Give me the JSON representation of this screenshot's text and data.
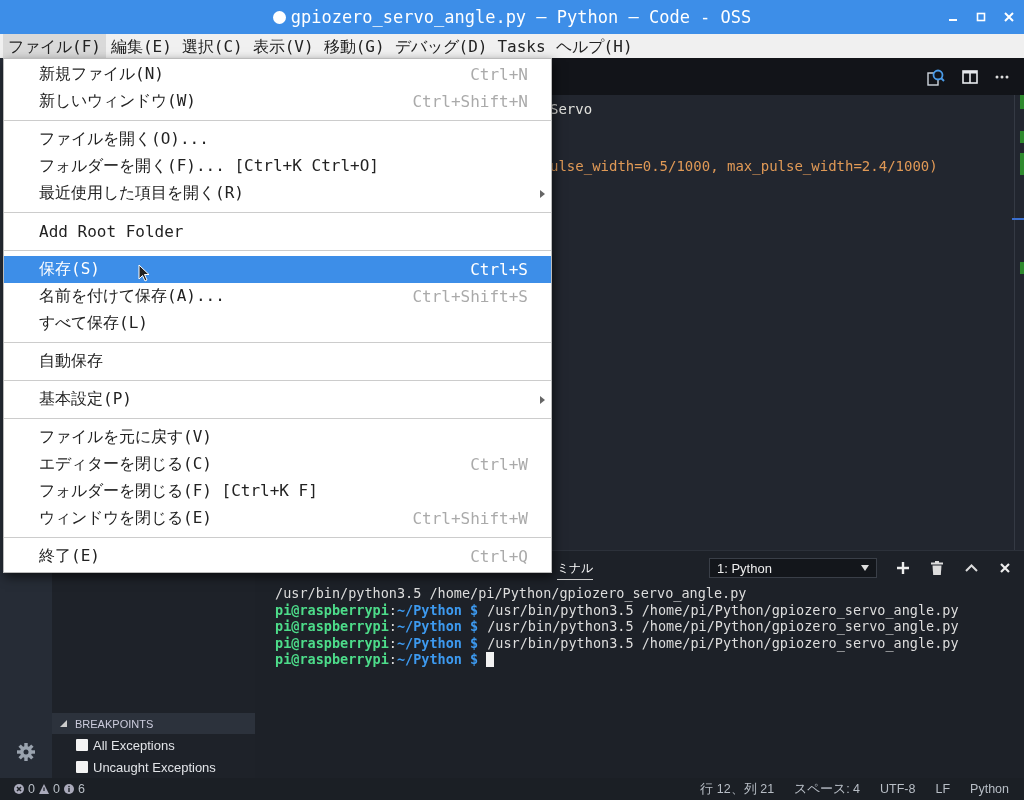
{
  "window": {
    "title": "gpiozero_servo_angle.py — Python — Code - OSS",
    "unsaved": true
  },
  "menubar": [
    {
      "label": "ファイル(F)",
      "selected": true
    },
    {
      "label": "編集(E)",
      "selected": false
    },
    {
      "label": "選択(C)",
      "selected": false
    },
    {
      "label": "表示(V)",
      "selected": false
    },
    {
      "label": "移動(G)",
      "selected": false
    },
    {
      "label": "デバッグ(D)",
      "selected": false
    },
    {
      "label": "Tasks",
      "selected": false
    },
    {
      "label": "ヘルプ(H)",
      "selected": false
    }
  ],
  "file_menu": [
    [
      {
        "label": "新規ファイル(N)",
        "shortcut": "Ctrl+N",
        "submenu": false,
        "selected": false
      },
      {
        "label": "新しいウィンドウ(W)",
        "shortcut": "Ctrl+Shift+N",
        "submenu": false,
        "selected": false
      }
    ],
    [
      {
        "label": "ファイルを開く(O)...",
        "submenu": false,
        "selected": false
      },
      {
        "label": "フォルダーを開く(F)... [Ctrl+K Ctrl+O]",
        "submenu": false,
        "selected": false
      },
      {
        "label": "最近使用した項目を開く(R)",
        "submenu": true,
        "selected": false
      }
    ],
    [
      {
        "label": "Add Root Folder",
        "submenu": false,
        "selected": false
      }
    ],
    [
      {
        "label": "保存(S)",
        "shortcut": "Ctrl+S",
        "submenu": false,
        "selected": true
      },
      {
        "label": "名前を付けて保存(A)...",
        "shortcut": "Ctrl+Shift+S",
        "submenu": false,
        "selected": false
      },
      {
        "label": "すべて保存(L)",
        "submenu": false,
        "selected": false
      }
    ],
    [
      {
        "label": "自動保存",
        "submenu": false,
        "selected": false
      }
    ],
    [
      {
        "label": "基本設定(P)",
        "submenu": true,
        "selected": false
      }
    ],
    [
      {
        "label": "ファイルを元に戻す(V)",
        "submenu": false,
        "selected": false
      },
      {
        "label": "エディターを閉じる(C)",
        "shortcut": "Ctrl+W",
        "submenu": false,
        "selected": false
      },
      {
        "label": "フォルダーを閉じる(F) [Ctrl+K F]",
        "submenu": false,
        "selected": false
      },
      {
        "label": "ウィンドウを閉じる(E)",
        "shortcut": "Ctrl+Shift+W",
        "submenu": false,
        "selected": false
      }
    ],
    [
      {
        "label": "終了(E)",
        "shortcut": "Ctrl+Q",
        "submenu": false,
        "selected": false
      }
    ]
  ],
  "editor": {
    "lines": [
      {
        "text": "Servo",
        "kind": "plain"
      },
      {
        "text": "ulse_width=0.5/1000, max_pulse_width=2.4/1000)",
        "kind": "args"
      }
    ]
  },
  "sidebar": {
    "breakpoints": {
      "title": "BREAKPOINTS",
      "expanded": true,
      "items": [
        {
          "label": "All Exceptions",
          "checked": false
        },
        {
          "label": "Uncaught Exceptions",
          "checked": false
        }
      ]
    }
  },
  "panel": {
    "tabs": [
      {
        "label": "ミナル",
        "selected": true
      }
    ],
    "terminal_select": "1: Python",
    "lines": [
      {
        "kind": "output",
        "text": "/usr/bin/python3.5 /home/pi/Python/gpiozero_servo_angle.py"
      },
      {
        "kind": "prompt",
        "user": "pi@raspberrypi",
        "sep": ":",
        "path": "~/Python $",
        "text": "/usr/bin/python3.5 /home/pi/Python/gpiozero_servo_angle.py"
      },
      {
        "kind": "prompt",
        "user": "pi@raspberrypi",
        "sep": ":",
        "path": "~/Python $",
        "text": "/usr/bin/python3.5 /home/pi/Python/gpiozero_servo_angle.py"
      },
      {
        "kind": "prompt",
        "user": "pi@raspberrypi",
        "sep": ":",
        "path": "~/Python $",
        "text": "/usr/bin/python3.5 /home/pi/Python/gpiozero_servo_angle.py"
      },
      {
        "kind": "prompt",
        "user": "pi@raspberrypi",
        "sep": ":",
        "path": "~/Python $",
        "cursor": true
      }
    ]
  },
  "status_bar": {
    "errors": "0",
    "warnings": "0",
    "infos": "6",
    "items": [
      "行 12、列 21",
      "スペース: 4",
      "UTF-8",
      "LF",
      "Python"
    ]
  }
}
